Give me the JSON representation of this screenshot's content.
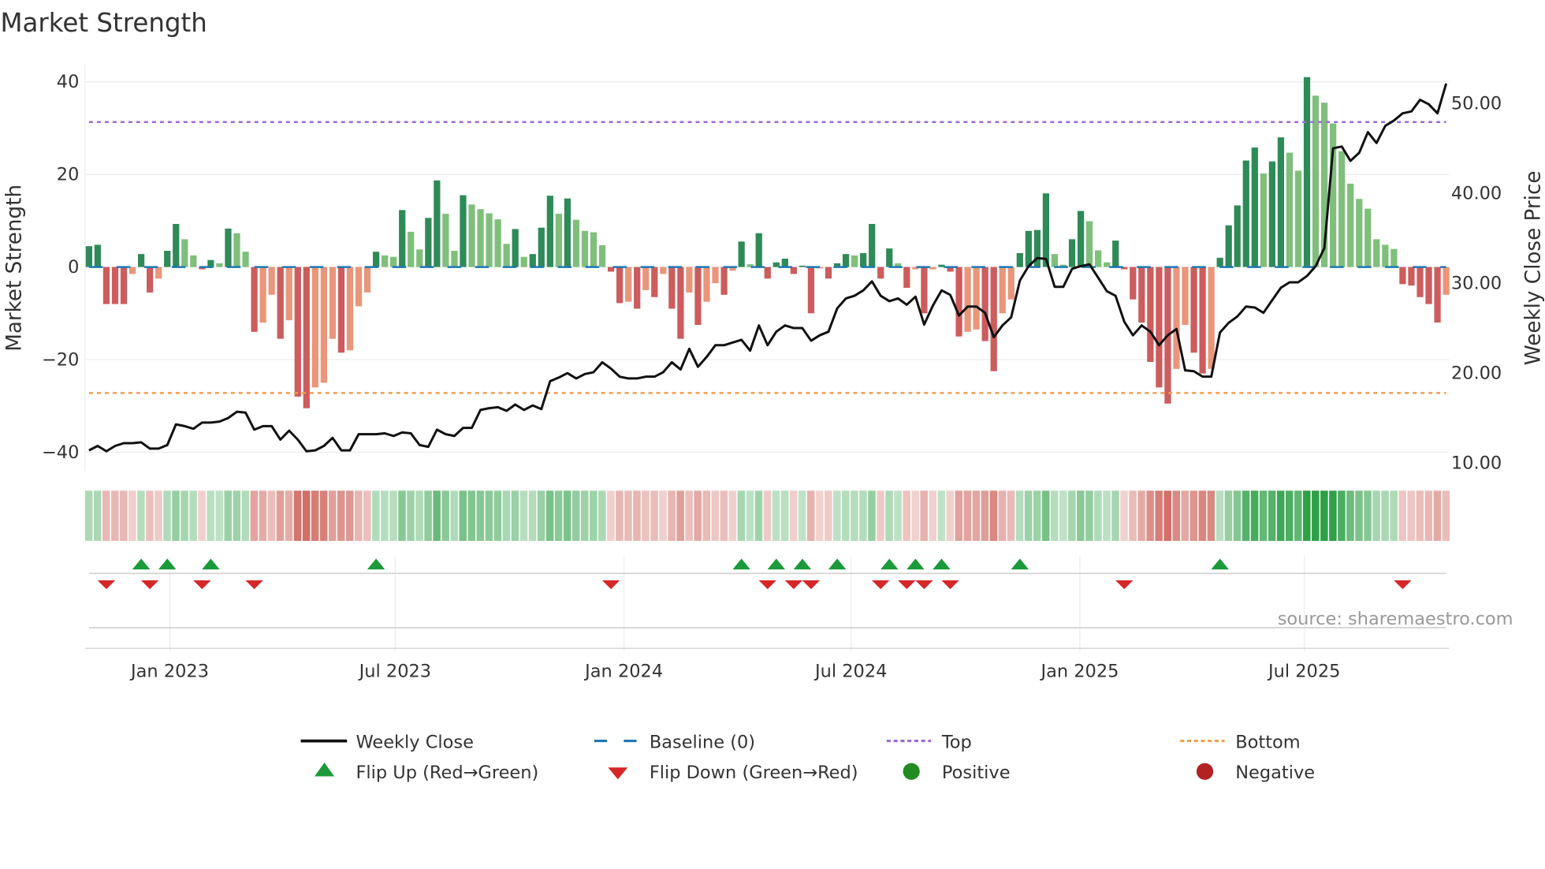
{
  "chart_data": {
    "type": "bar",
    "title": "Market Strength",
    "ylabel": "Market Strength",
    "y2label": "Weekly Close Price",
    "source": "source: sharemaestro.com",
    "interval": "weekly",
    "ylim": [
      -44,
      44
    ],
    "y2lim": [
      7.8,
      52.2
    ],
    "yticks": [
      40,
      20,
      0,
      -20,
      -40
    ],
    "ytick_labels": [
      "40",
      "20",
      "0",
      "−20",
      "−40"
    ],
    "y2ticks": [
      50,
      40,
      30,
      20,
      10
    ],
    "y2tick_labels": [
      "50.00",
      "40.00",
      "30.00",
      "20.00",
      "10.00"
    ],
    "xticks": [
      {
        "label": "Jan 2023",
        "week_index": 9.3
      },
      {
        "label": "Jul 2023",
        "week_index": 35.2
      },
      {
        "label": "Jan 2024",
        "week_index": 61.5
      },
      {
        "label": "Jul 2024",
        "week_index": 87.6
      },
      {
        "label": "Jan 2025",
        "week_index": 113.9
      },
      {
        "label": "Jul 2025",
        "week_index": 139.7
      }
    ],
    "top_level": 31.3,
    "bottom_level": -27.2,
    "baseline": 0,
    "strength": [
      4.5,
      4.8,
      -8,
      -8,
      -8,
      -1.5,
      2.8,
      -5.5,
      -2.5,
      3.5,
      9.3,
      6,
      2.5,
      -0.5,
      1.5,
      0.8,
      8.3,
      7.3,
      3.3,
      -14,
      -12,
      -6,
      -15.5,
      -11.5,
      -28,
      -30.5,
      -26,
      -25,
      -15.5,
      -18.5,
      -18,
      -8.5,
      -5.5,
      3.3,
      2.5,
      2.2,
      12.3,
      7.6,
      3.8,
      10.6,
      18.7,
      11.5,
      3.5,
      15.5,
      13.5,
      12.5,
      11.6,
      10.3,
      5,
      8.2,
      2.2,
      2.8,
      8.5,
      15.4,
      11.5,
      14.8,
      10.2,
      7.8,
      7.5,
      4.7,
      -1,
      -7.8,
      -7.5,
      -9,
      -5,
      -6.5,
      -1.5,
      -9,
      -15.5,
      -5.5,
      -12.5,
      -7.5,
      -3.5,
      -6,
      -0.8,
      5.5,
      0.6,
      7.3,
      -2.5,
      1,
      1.8,
      -1.5,
      0.3,
      -10,
      -0.3,
      -2.5,
      0.8,
      2.8,
      2.5,
      3,
      9.3,
      -2.5,
      4,
      0.8,
      -4.5,
      -0.5,
      -10,
      -0.5,
      0.5,
      -1,
      -15,
      -14,
      -13.5,
      -16,
      -22.5,
      -10,
      -7,
      3,
      7.8,
      8,
      15.9,
      2.8,
      0.5,
      6,
      12.1,
      9.9,
      3.6,
      1,
      5.7,
      -0.5,
      -7,
      -12,
      -20.5,
      -26,
      -29.5,
      -22,
      -12.5,
      -18.5,
      -23,
      -22,
      2,
      9,
      13.3,
      23,
      25.8,
      20.2,
      22.8,
      28,
      24.7,
      20.8,
      41,
      37,
      35.5,
      31,
      25,
      18,
      14.7,
      12.6,
      6,
      4.8,
      3.9,
      -3.7,
      -4,
      -6.5,
      -8,
      -12,
      -6
    ],
    "weekly_close": [
      11.3,
      11.8,
      11.2,
      11.8,
      12.1,
      12.1,
      12.2,
      11.5,
      11.5,
      11.9,
      14.2,
      14.0,
      13.7,
      14.4,
      14.4,
      14.5,
      14.9,
      15.6,
      15.5,
      13.6,
      14.0,
      14.0,
      12.5,
      13.5,
      12.5,
      11.2,
      11.3,
      11.8,
      12.7,
      11.3,
      11.3,
      13.1,
      13.1,
      13.1,
      13.2,
      12.9,
      13.3,
      13.2,
      11.9,
      11.7,
      13.6,
      13.1,
      12.9,
      13.8,
      13.8,
      15.8,
      16.0,
      16.1,
      15.7,
      16.4,
      15.8,
      16.3,
      15.9,
      19.0,
      19.4,
      19.9,
      19.3,
      19.8,
      20.0,
      21.1,
      20.4,
      19.5,
      19.3,
      19.3,
      19.5,
      19.5,
      20.0,
      21.1,
      20.3,
      22.6,
      20.6,
      21.7,
      23.0,
      23.0,
      23.3,
      23.6,
      22.4,
      25.2,
      23.0,
      24.5,
      25.2,
      24.9,
      24.9,
      23.5,
      24.1,
      24.5,
      27.1,
      28.2,
      28.5,
      29.1,
      30.1,
      28.5,
      27.9,
      28.2,
      27.5,
      28.4,
      25.3,
      27.4,
      29.1,
      28.6,
      26.3,
      27.3,
      27.3,
      26.6,
      23.9,
      25.2,
      26.1,
      30.2,
      31.8,
      32.7,
      32.6,
      29.5,
      29.5,
      31.5,
      31.8,
      32.0,
      30.5,
      29.0,
      28.5,
      25.6,
      24.1,
      25.2,
      24.5,
      23.0,
      24.1,
      24.8,
      20.2,
      20.1,
      19.5,
      19.5,
      24.4,
      25.5,
      26.2,
      27.3,
      27.2,
      26.6,
      28.0,
      29.4,
      30.0,
      30.0,
      30.7,
      31.8,
      33.8,
      44.9,
      45.1,
      43.5,
      44.4,
      46.7,
      45.5,
      47.4,
      48.0,
      48.8,
      49.0,
      50.3,
      49.8,
      48.8,
      52.1
    ],
    "flip_up_weeks": [
      6,
      9,
      14,
      33,
      75,
      79,
      82,
      86,
      92,
      95,
      98,
      107,
      130
    ],
    "flip_down_weeks": [
      2,
      7,
      13,
      19,
      60,
      78,
      81,
      83,
      91,
      94,
      96,
      99,
      119,
      151
    ],
    "legend": [
      {
        "label": "Weekly Close",
        "marker": "line",
        "color": "#111111"
      },
      {
        "label": "Baseline (0)",
        "marker": "dashed",
        "color": "#1f77b4"
      },
      {
        "label": "Top",
        "marker": "dotted",
        "color": "#9b6bd6"
      },
      {
        "label": "Bottom",
        "marker": "dotted",
        "color": "#f0a050"
      },
      {
        "label": "Flip Up (Red→Green)",
        "marker": "triangle-up",
        "color": "#1a9a3a"
      },
      {
        "label": "Flip Down (Green→Red)",
        "marker": "triangle-down",
        "color": "#d62728"
      },
      {
        "label": "Positive",
        "marker": "circle",
        "color": "#228b22"
      },
      {
        "label": "Negative",
        "marker": "circle",
        "color": "#b22222"
      }
    ],
    "colors": {
      "pos_strong": "#2e8b57",
      "pos_weak": "#7fbf7b",
      "neg_strong": "#cd5c5c",
      "neg_weak": "#e9967a",
      "baseline": "#1f77b4",
      "top": "#9b6bd6",
      "bottom": "#f0a050",
      "price": "#111111"
    }
  }
}
